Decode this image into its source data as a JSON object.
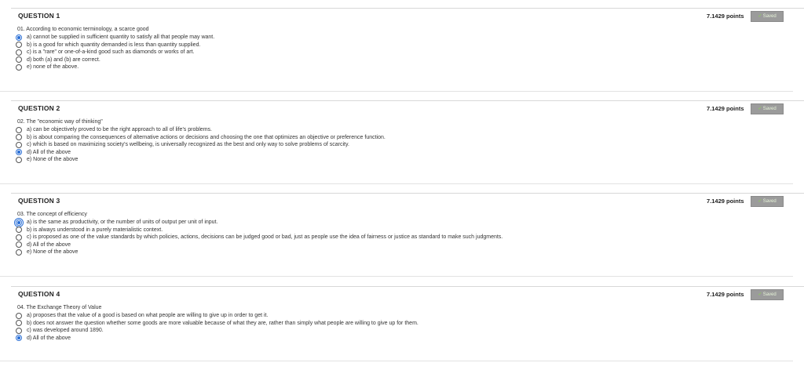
{
  "saved_label": "Saved",
  "questions": [
    {
      "title": "QUESTION 1",
      "points": "7.1429 points",
      "stem": "01. According to economic terminology, a scarce good",
      "options": [
        {
          "text": "a) cannot be supplied in sufficient quantity to satisfy all that people may want.",
          "selected": true
        },
        {
          "text": "b) is a good for which quantity demanded is less than quantity supplied.",
          "selected": false
        },
        {
          "text": "c) is a \"rare\" or one-of-a-kind good such as diamonds or works of art.",
          "selected": false
        },
        {
          "text": "d) both (a) and (b) are correct.",
          "selected": false
        },
        {
          "text": "e) none of the above.",
          "selected": false
        }
      ]
    },
    {
      "title": "QUESTION 2",
      "points": "7.1429 points",
      "stem": "02. The \"economic way of thinking\"",
      "options": [
        {
          "text": "a) can be objectively proved to be the right approach to all of life's problems.",
          "selected": false
        },
        {
          "text": "b) is about comparing the consequences of alternative actions or decisions and choosing the one that optimizes an objective or preference function.",
          "selected": false
        },
        {
          "text": "c) which is based on maximizing society's wellbeing, is universally recognized as the best and only way to solve problems of scarcity.",
          "selected": false
        },
        {
          "text": "d) All of the above",
          "selected": true
        },
        {
          "text": "e) None of the above",
          "selected": false
        }
      ]
    },
    {
      "title": "QUESTION 3",
      "points": "7.1429 points",
      "stem": "03. The concept of efficiency",
      "options": [
        {
          "text": "a) is the same as productivity, or the number of units of output per unit of input.",
          "selected": true,
          "focus": true
        },
        {
          "text": "b) is always understood in a purely materialistic context.",
          "selected": false
        },
        {
          "text": "c) is proposed as one of the value standards by which policies, actions, decisions can be judged good or bad, just as people use the idea of fairness or justice as standard to make such judgments.",
          "selected": false
        },
        {
          "text": "d) All of the above",
          "selected": false
        },
        {
          "text": "e) None of the above",
          "selected": false
        }
      ]
    },
    {
      "title": "QUESTION 4",
      "points": "7.1429 points",
      "stem": "04. The Exchange Theory of Value",
      "options": [
        {
          "text": "a) proposes that the value of a good is based on what people are willing to give up in order to get it.",
          "selected": false
        },
        {
          "text": "b) does not answer the question whether some goods are more valuable because of what they are, rather than simply what people are willing to give up for them.",
          "selected": false
        },
        {
          "text": "c) was developed around 1890.",
          "selected": false
        },
        {
          "text": "d) All of the above",
          "selected": true
        }
      ]
    }
  ]
}
